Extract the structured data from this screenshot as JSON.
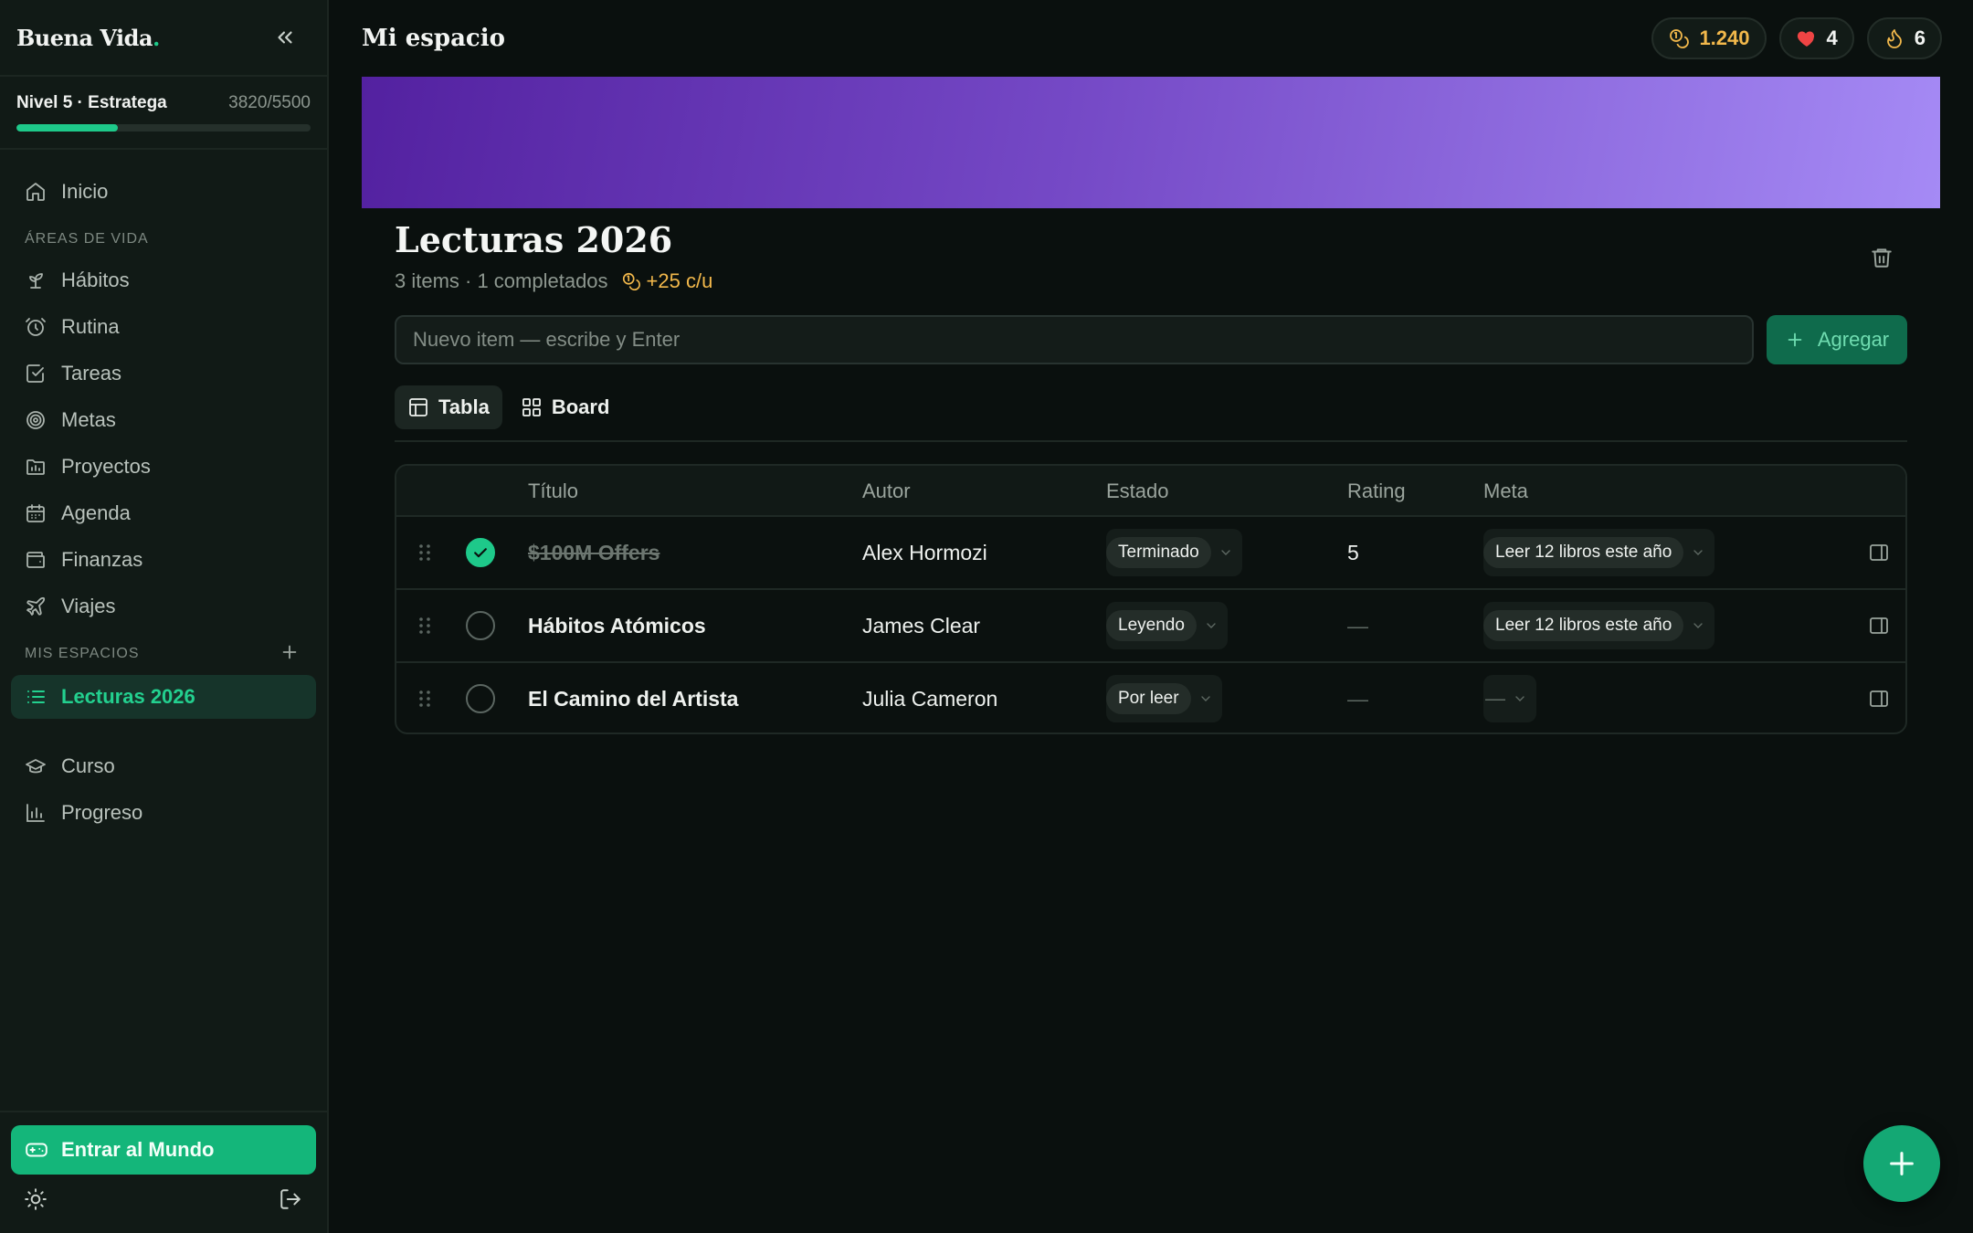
{
  "brand": {
    "name": "Buena Vida",
    "dot": "."
  },
  "level": {
    "label": "Nivel 5 · Estratega",
    "xp": "3820/5500",
    "progress_fraction": 0.345
  },
  "sidebar": {
    "home": "Inicio",
    "areas_label": "ÁREAS DE VIDA",
    "areas": [
      {
        "label": "Hábitos",
        "icon": "sprout-icon"
      },
      {
        "label": "Rutina",
        "icon": "alarm-clock-icon"
      },
      {
        "label": "Tareas",
        "icon": "check-square-icon"
      },
      {
        "label": "Metas",
        "icon": "target-icon"
      },
      {
        "label": "Proyectos",
        "icon": "folder-chart-icon"
      },
      {
        "label": "Agenda",
        "icon": "calendar-icon"
      },
      {
        "label": "Finanzas",
        "icon": "wallet-icon"
      },
      {
        "label": "Viajes",
        "icon": "plane-icon"
      }
    ],
    "spaces_label": "MIS ESPACIOS",
    "active_space": "Lecturas 2026",
    "course": "Curso",
    "progress": "Progreso",
    "enter_world": "Entrar al Mundo"
  },
  "header": {
    "title": "Mi espacio",
    "stats": {
      "coins": "1.240",
      "hearts": "4",
      "streak": "6"
    }
  },
  "space": {
    "title": "Lecturas 2026",
    "meta": "3 items · 1 completados",
    "reward": "+25 c/u",
    "cover_colors": [
      "#5321a0",
      "#a58af5"
    ]
  },
  "add_item": {
    "placeholder": "Nuevo item — escribe y Enter",
    "button": "Agregar"
  },
  "views": {
    "table": "Tabla",
    "board": "Board"
  },
  "table": {
    "columns": [
      "Título",
      "Autor",
      "Estado",
      "Rating",
      "Meta"
    ],
    "rows": [
      {
        "done": true,
        "title": "$100M Offers",
        "author": "Alex Hormozi",
        "status": "Terminado",
        "rating": "5",
        "goal": "Leer 12 libros este año"
      },
      {
        "done": false,
        "title": "Hábitos Atómicos",
        "author": "James Clear",
        "status": "Leyendo",
        "rating": "—",
        "goal": "Leer 12 libros este año"
      },
      {
        "done": false,
        "title": "El Camino del Artista",
        "author": "Julia Cameron",
        "status": "Por leer",
        "rating": "—",
        "goal": "—"
      }
    ]
  },
  "colors": {
    "accent": "#1ec98a",
    "coins": "#f2b84b",
    "heart": "#ef4444",
    "background": "#0a100e"
  }
}
